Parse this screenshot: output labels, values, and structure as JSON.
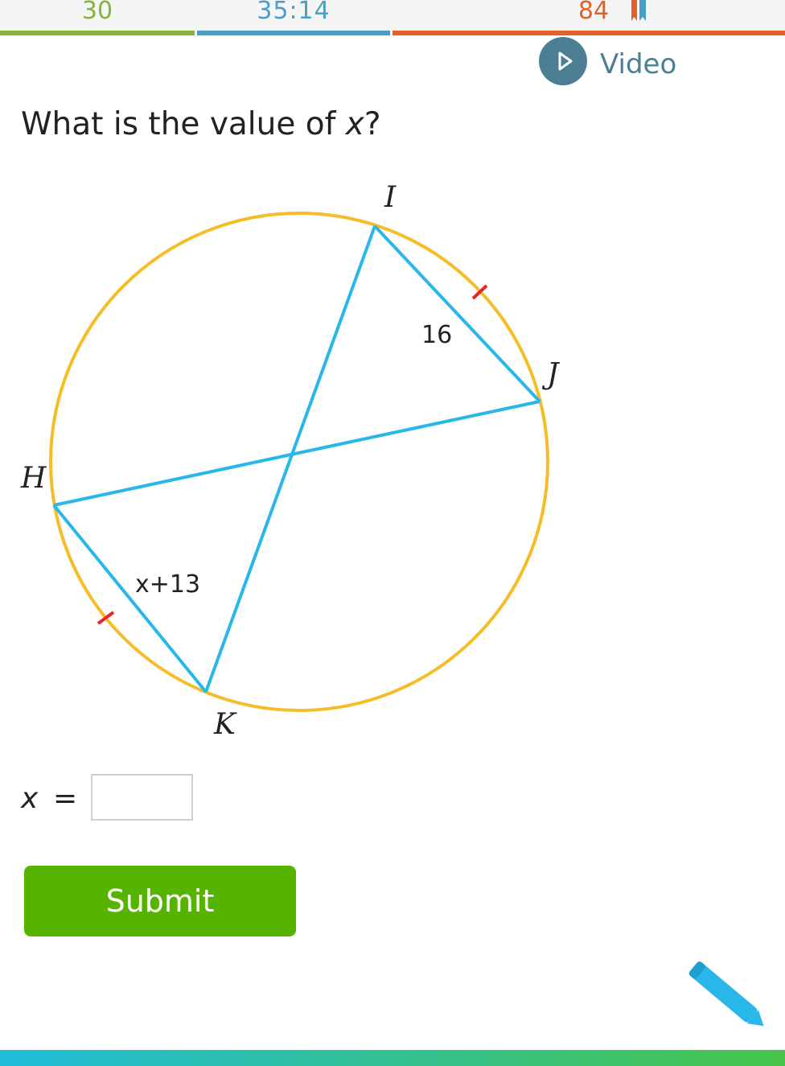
{
  "stats": {
    "answered": "30",
    "time": "35:14",
    "score": "84"
  },
  "video": {
    "label": "Video"
  },
  "question": {
    "prefix": "What is the value of ",
    "variable": "x",
    "suffix": "?"
  },
  "diagram": {
    "points": {
      "I": "I",
      "J": "J",
      "H": "H",
      "K": "K"
    },
    "labels": {
      "ij": "16",
      "hk": "x+13"
    }
  },
  "answer": {
    "variable": "x",
    "equals": "=",
    "value": ""
  },
  "submit": {
    "label": "Submit"
  },
  "colors": {
    "circle": "#f5bd27",
    "chord": "#29b7ea",
    "tick": "#e8262a",
    "submit": "#56b400"
  }
}
